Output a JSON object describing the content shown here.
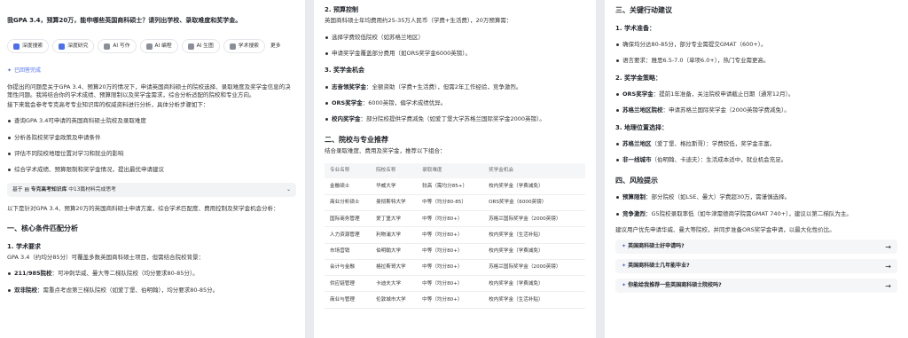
{
  "panel1": {
    "question": "我GPA 3.4，预算20万，能申哪些英国商科硕士？请列出学校、录取难度和奖学金。",
    "tools": [
      "深度搜索",
      "深度研究",
      "AI 写作",
      "AI 编程",
      "AI 生图",
      "学术搜索",
      "更多"
    ],
    "status": "已回答完成",
    "intro": "你提出的问题是关于GPA 3.4、预算20万的情况下，申请英国商科硕士的院校选择、录取难度及奖学金信息的决策性问题。我将结合你的学术成绩、预算限制以及奖学金需求，综合分析适配的院校和专业方向。",
    "intro2": "接下来我会参考专克高考专业知识库的权威资料进行分析，具体分析步骤如下：",
    "steps": [
      "查询GPA 3.4可申请的英国商科硕士院校及录取难度",
      "分析各院校奖学金政策及申请条件",
      "评估不同院校地理位置对学习和就业的影响",
      "综合学术成绩、预算限制和奖学金情况，提出最优申请建议"
    ],
    "source_prefix": "基于",
    "source_name": "专克高考知识库",
    "source_suffix": "中13篇材料完成思考",
    "summary": "以下是针对GPA 3.4、预算20万的英国商科硕士申请方案，综合学术匹配度、费用控制及奖学金机会分析：",
    "h_section": "一、核心条件匹配分析",
    "h_academic": "1. 学术要求",
    "academic_text": "GPA 3.4（约均分85分）可覆盖多数英国商科硕士项目，但需结合院校背景：",
    "academic_items": [
      {
        "bold": "211/985院校",
        "text": "：可冲刺华威、曼大等二梯队院校（均分要求80-85分）。"
      },
      {
        "bold": "双非院校",
        "text": "：需重点考虑第三梯队院校（如爱丁堡、伯明翰），均分要求80-85分。"
      }
    ]
  },
  "panel2": {
    "h_budget": "2. 预算控制",
    "budget_text": "英国商科硕士年均费用约25-35万人民币（学费+生活费），20万预算需：",
    "budget_items": [
      "选择学费较低院校（如苏格兰地区）",
      "申请奖学金覆盖部分费用（如ORS奖学金6000英镑）。"
    ],
    "h_scholar": "3. 奖学金机会",
    "scholar_items": [
      {
        "bold": "志奋领奖学金",
        "text": "：全额资助（学费+生活费），但需2年工作经验，竞争激烈。"
      },
      {
        "bold": "ORS奖学金",
        "text": "：6000英镑，偏学术成绩优异。"
      },
      {
        "bold": "校内奖学金",
        "text": "：部分院校提供学费减免（如爱丁堡大学苏格兰国际奖学金2000英镑）。"
      }
    ],
    "h_section2": "二、院校与专业推荐",
    "section2_text": "结合录取难度、费用及奖学金，推荐以下组合：",
    "table": {
      "headers": [
        "专业名称",
        "院校名称",
        "录取难度",
        "奖学金机会"
      ],
      "rows": [
        [
          "金融硕士",
          "华威大学",
          "较高（需均分85+）",
          "校内奖学金（学费减免）"
        ],
        [
          "商业分析硕士",
          "曼彻斯特大学",
          "中等（均分80-85）",
          "ORS奖学金（6000英镑）"
        ],
        [
          "国际商务管理",
          "爱丁堡大学",
          "中等（均分80+）",
          "苏格兰国际奖学金（2000英镑）"
        ],
        [
          "人力资源管理",
          "利物浦大学",
          "中等（均分80+）",
          "校内奖学金（生活补贴）"
        ],
        [
          "市场营销",
          "伯明翰大学",
          "中等（均分80+）",
          "校内奖学金（学费减免）"
        ],
        [
          "会计与金融",
          "格拉斯哥大学",
          "中等（均分80+）",
          "苏格兰国际奖学金（2000英镑）"
        ],
        [
          "供应链管理",
          "卡迪夫大学",
          "中等（均分80+）",
          "校内奖学金（学费减免）"
        ],
        [
          "商业与管理",
          "伦敦城市大学",
          "中等（均分80+）",
          "校内奖学金（生活补贴）"
        ]
      ]
    }
  },
  "panel3": {
    "h_section3": "三、关键行动建议",
    "h_prep": "1. 学术准备：",
    "prep_items": [
      "确保均分达80-85分，部分专业需提交GMAT（600+）。",
      "语言要求：雅思6.5-7.0（单项6.0+），热门专业需更高。"
    ],
    "h_scholar2": "2. 奖学金策略：",
    "scholar2_items": [
      {
        "bold": "ORS奖学金",
        "text": "：提前1年准备，关注院校申请截止日期（通常12月）。"
      },
      {
        "bold": "苏格兰地区院校",
        "text": "：申请苏格兰国际奖学金（2000英镑学费减免）。"
      }
    ],
    "h_location": "3. 地理位置选择：",
    "location_items": [
      {
        "bold": "苏格兰地区",
        "text": "（爱丁堡、格拉斯哥）：学费较低，奖学金丰富。"
      },
      {
        "bold": "非一线城市",
        "text": "（伯明翰、卡迪夫）：生活成本适中，就业机会充足。"
      }
    ],
    "h_section4": "四、风险提示",
    "risk_items": [
      {
        "bold": "预算限制",
        "text": "：部分院校（如LSE、曼大）学费超30万，需谨慎选择。"
      },
      {
        "bold": "竞争激烈",
        "text": "：G5院校录取率低（如牛津需德商学院需GMAT 740+），建议以第二梯队为主。"
      }
    ],
    "advice": "建议用户优先申请华威、曼大等院校，并同步准备ORS奖学金申请，以最大化性价比。",
    "suggestions": [
      "英国商科硕士好申请吗?",
      "英国商科硕士几年能毕业?",
      "你能给我推荐一些英国商科硕士院校吗?"
    ]
  },
  "colors": {
    "accent": "#4e6ef2",
    "text": "#1f2329",
    "background": "#e9eaee"
  }
}
